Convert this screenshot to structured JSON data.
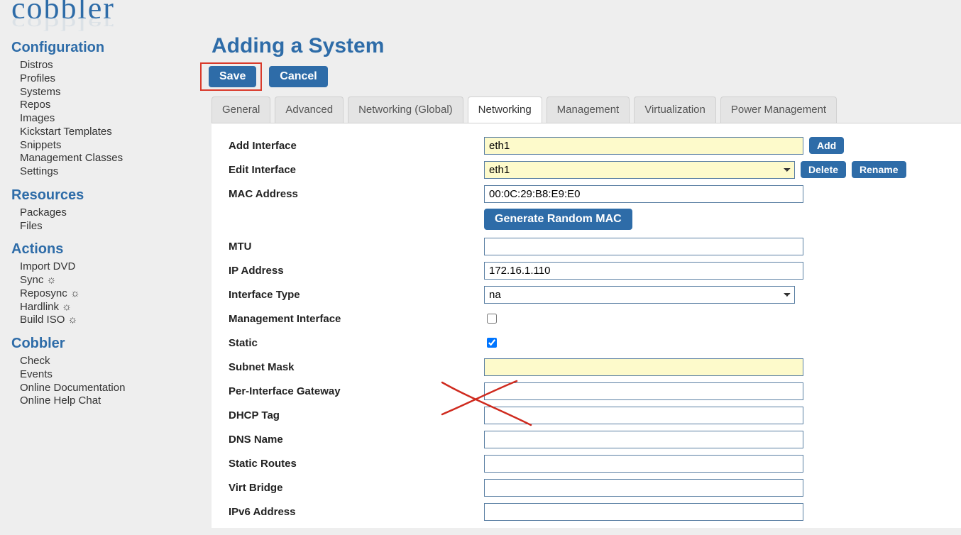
{
  "logo_text": "cobbler",
  "sidebar": {
    "sections": [
      {
        "title": "Configuration",
        "items": [
          "Distros",
          "Profiles",
          "Systems",
          "Repos",
          "Images",
          "Kickstart Templates",
          "Snippets",
          "Management Classes",
          "Settings"
        ]
      },
      {
        "title": "Resources",
        "items": [
          "Packages",
          "Files"
        ]
      },
      {
        "title": "Actions",
        "items": [
          "Import DVD",
          "Sync ☼",
          "Reposync ☼",
          "Hardlink ☼",
          "Build ISO ☼"
        ]
      },
      {
        "title": "Cobbler",
        "items": [
          "Check",
          "Events",
          "Online Documentation",
          "Online Help Chat"
        ]
      }
    ]
  },
  "page": {
    "title": "Adding a System",
    "save_label": "Save",
    "cancel_label": "Cancel"
  },
  "tabs": [
    "General",
    "Advanced",
    "Networking (Global)",
    "Networking",
    "Management",
    "Virtualization",
    "Power Management"
  ],
  "active_tab_index": 3,
  "form": {
    "add_interface": {
      "label": "Add Interface",
      "value": "eth1",
      "add_btn": "Add"
    },
    "edit_interface": {
      "label": "Edit Interface",
      "value": "eth1",
      "delete_btn": "Delete",
      "rename_btn": "Rename"
    },
    "mac_address": {
      "label": "MAC Address",
      "value": "00:0C:29:B8:E9:E0",
      "gen_btn": "Generate Random MAC"
    },
    "mtu": {
      "label": "MTU",
      "value": ""
    },
    "ip_address": {
      "label": "IP Address",
      "value": "172.16.1.110"
    },
    "interface_type": {
      "label": "Interface Type",
      "value": "na"
    },
    "mgmt_iface": {
      "label": "Management Interface",
      "checked": false
    },
    "static": {
      "label": "Static",
      "checked": true
    },
    "subnet_mask": {
      "label": "Subnet Mask",
      "value": ""
    },
    "gateway": {
      "label": "Per-Interface Gateway",
      "value": ""
    },
    "dhcp_tag": {
      "label": "DHCP Tag",
      "value": ""
    },
    "dns_name": {
      "label": "DNS Name",
      "value": ""
    },
    "static_routes": {
      "label": "Static Routes",
      "value": ""
    },
    "virt_bridge": {
      "label": "Virt Bridge",
      "value": ""
    },
    "ipv6_addr": {
      "label": "IPv6 Address",
      "value": ""
    }
  }
}
